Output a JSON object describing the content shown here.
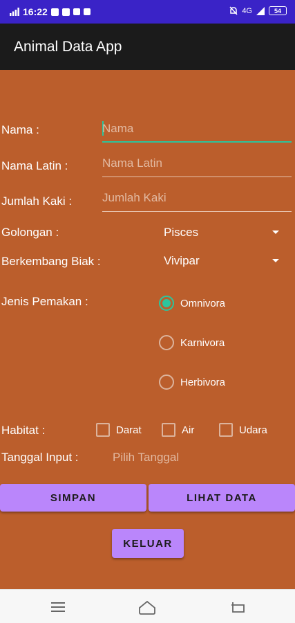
{
  "status_bar": {
    "time": "16:22",
    "network": "4G",
    "battery": "54"
  },
  "app_bar": {
    "title": "Animal Data App"
  },
  "form": {
    "nama": {
      "label": "Nama :",
      "placeholder": "Nama"
    },
    "nama_latin": {
      "label": "Nama Latin :",
      "placeholder": "Nama Latin"
    },
    "jumlah_kaki": {
      "label": "Jumlah Kaki :",
      "placeholder": "Jumlah Kaki"
    },
    "golongan": {
      "label": "Golongan :",
      "value": "Pisces"
    },
    "berkembang_biak": {
      "label": "Berkembang Biak :",
      "value": "Vivipar"
    },
    "jenis_pemakan": {
      "label": "Jenis Pemakan :",
      "options": [
        {
          "label": "Omnivora",
          "checked": true
        },
        {
          "label": "Karnivora",
          "checked": false
        },
        {
          "label": "Herbivora",
          "checked": false
        }
      ]
    },
    "habitat": {
      "label": "Habitat :",
      "options": [
        {
          "label": "Darat",
          "checked": false
        },
        {
          "label": "Air",
          "checked": false
        },
        {
          "label": "Udara",
          "checked": false
        }
      ]
    },
    "tanggal_input": {
      "label": "Tanggal Input :",
      "placeholder": "Pilih Tanggal"
    }
  },
  "buttons": {
    "simpan": "SIMPAN",
    "lihat_data": "LIHAT DATA",
    "keluar": "KELUAR"
  },
  "nav_bar": {
    "icons": [
      "menu-icon",
      "home-icon",
      "back-icon"
    ]
  },
  "colors": {
    "status_bar": "#3a23c7",
    "app_bar": "#1b1b1b",
    "background": "#bb5e2c",
    "accent": "#2bc59d",
    "button": "#ba86fb"
  }
}
